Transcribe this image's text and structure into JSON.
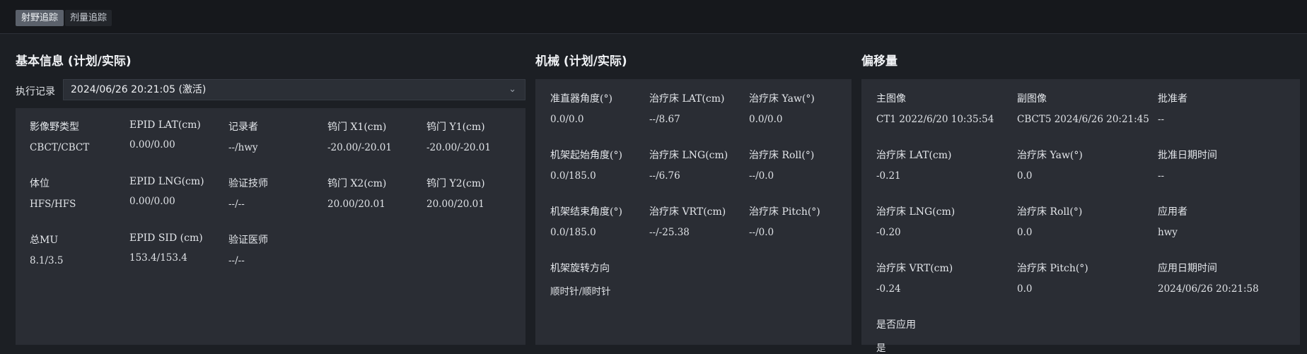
{
  "tabs": [
    "射野追踪",
    "剂量追踪"
  ],
  "basic": {
    "title": "基本信息 (计划/实际)",
    "exec_label": "执行记录",
    "exec_value": "2024/06/26 20:21:05 (激活)",
    "exec_chevron": "chevron-down-icon",
    "fields": [
      {
        "label": "影像野类型",
        "value": "CBCT/CBCT"
      },
      {
        "label": "EPID LAT(cm)",
        "value": "0.00/0.00"
      },
      {
        "label": "记录者",
        "value": "--/hwy"
      },
      {
        "label": "钨门 X1(cm)",
        "value": "-20.00/-20.01"
      },
      {
        "label": "钨门 Y1(cm)",
        "value": "-20.00/-20.01"
      },
      {
        "label": "体位",
        "value": "HFS/HFS"
      },
      {
        "label": "EPID LNG(cm)",
        "value": "0.00/0.00"
      },
      {
        "label": "验证技师",
        "value": "--/--"
      },
      {
        "label": "钨门 X2(cm)",
        "value": "20.00/20.01"
      },
      {
        "label": "钨门 Y2(cm)",
        "value": "20.00/20.01"
      },
      {
        "label": "总MU",
        "value": "8.1/3.5"
      },
      {
        "label": "EPID SID (cm)",
        "value": "153.4/153.4"
      },
      {
        "label": "验证医师",
        "value": "--/--"
      }
    ]
  },
  "mechanical": {
    "title": "机械 (计划/实际)",
    "fields": [
      {
        "label": "准直器角度(°)",
        "value": "0.0/0.0"
      },
      {
        "label": "治疗床 LAT(cm)",
        "value": "--/8.67"
      },
      {
        "label": "治疗床 Yaw(°)",
        "value": "0.0/0.0"
      },
      {
        "label": "机架起始角度(°)",
        "value": "0.0/185.0"
      },
      {
        "label": "治疗床 LNG(cm)",
        "value": "--/6.76"
      },
      {
        "label": "治疗床 Roll(°)",
        "value": "--/0.0"
      },
      {
        "label": "机架结束角度(°)",
        "value": "0.0/185.0"
      },
      {
        "label": "治疗床 VRT(cm)",
        "value": "--/-25.38"
      },
      {
        "label": "治疗床 Pitch(°)",
        "value": "--/0.0"
      },
      {
        "label": "机架旋转方向",
        "value": "顺时针/顺时针"
      }
    ]
  },
  "offset": {
    "title": "偏移量",
    "fields": [
      {
        "label": "主图像",
        "value": "CT1 2022/6/20 10:35:54"
      },
      {
        "label": "副图像",
        "value": "CBCT5 2024/6/26 20:21:45"
      },
      {
        "label": "批准者",
        "value": "--"
      },
      {
        "label": "治疗床 LAT(cm)",
        "value": "-0.21"
      },
      {
        "label": "治疗床 Yaw(°)",
        "value": "0.0"
      },
      {
        "label": "批准日期时间",
        "value": "--"
      },
      {
        "label": "治疗床 LNG(cm)",
        "value": "-0.20"
      },
      {
        "label": "治疗床 Roll(°)",
        "value": "0.0"
      },
      {
        "label": "应用者",
        "value": "hwy"
      },
      {
        "label": "治疗床 VRT(cm)",
        "value": "-0.24"
      },
      {
        "label": "治疗床 Pitch(°)",
        "value": "0.0"
      },
      {
        "label": "应用日期时间",
        "value": "2024/06/26 20:21:58"
      },
      {
        "label": "是否应用",
        "value": "是"
      }
    ]
  }
}
